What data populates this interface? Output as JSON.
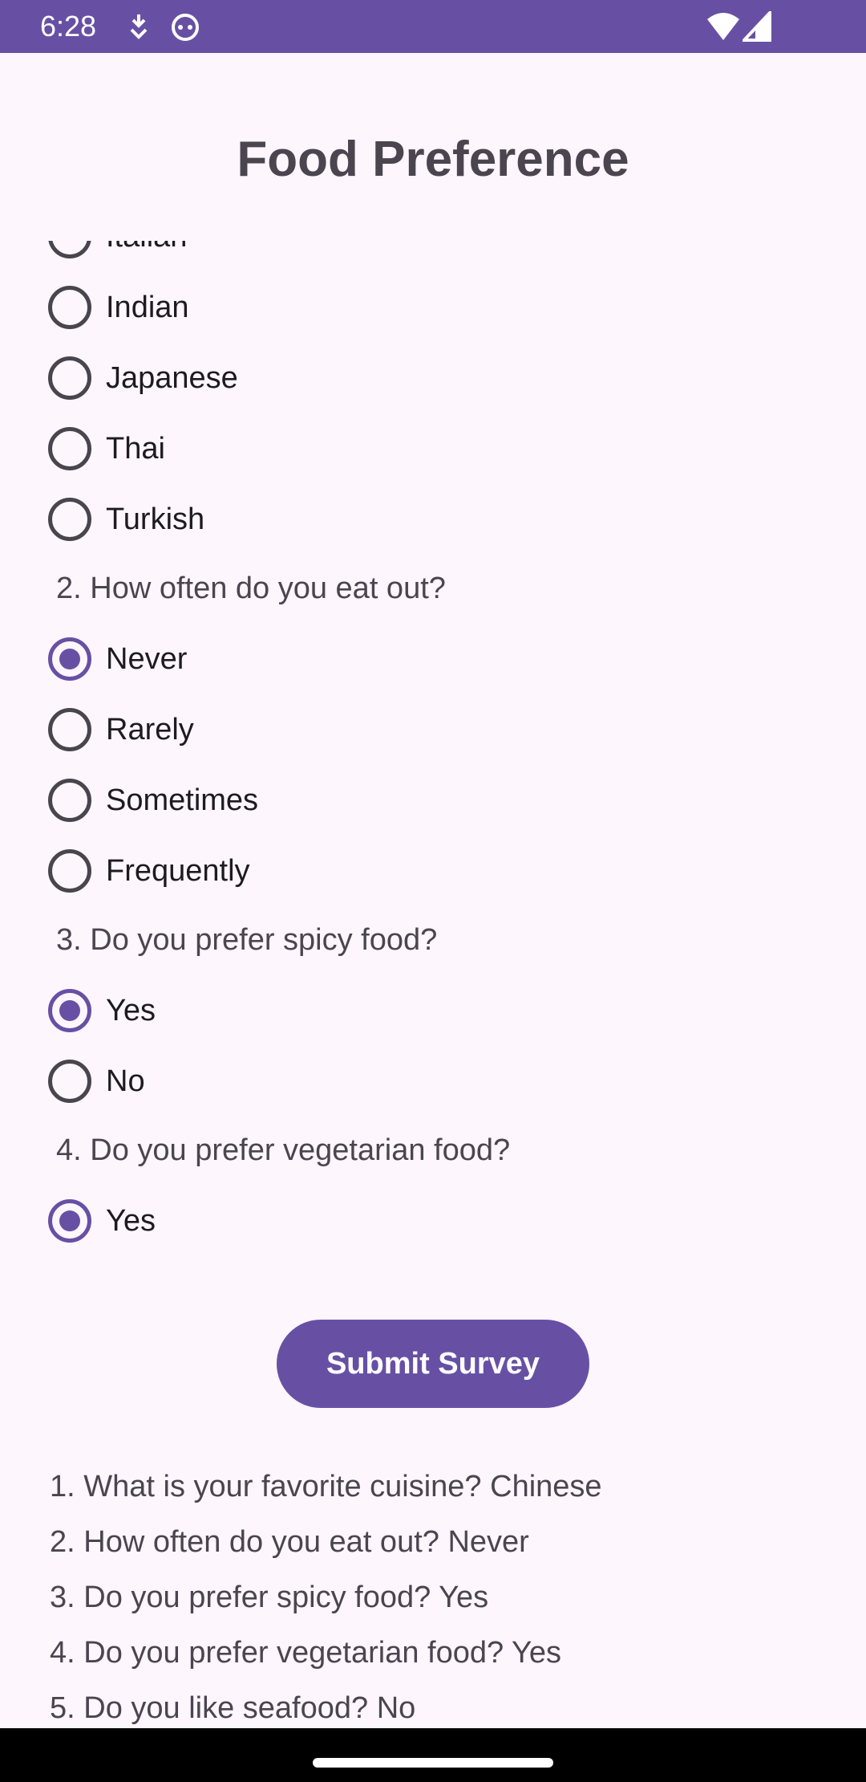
{
  "status_bar": {
    "time": "6:28",
    "icons": [
      "download-icon",
      "cat-face-icon",
      "wifi-icon",
      "cellular-signal-icon"
    ],
    "color": "#6750a4"
  },
  "title": "Food Preference",
  "questions": [
    {
      "label": "",
      "options": [
        {
          "label": "Italian",
          "checked": false
        },
        {
          "label": "Indian",
          "checked": false
        },
        {
          "label": "Japanese",
          "checked": false
        },
        {
          "label": "Thai",
          "checked": false
        },
        {
          "label": "Turkish",
          "checked": false
        }
      ]
    },
    {
      "label": "2. How often do you eat out?",
      "options": [
        {
          "label": "Never",
          "checked": true
        },
        {
          "label": "Rarely",
          "checked": false
        },
        {
          "label": "Sometimes",
          "checked": false
        },
        {
          "label": "Frequently",
          "checked": false
        }
      ]
    },
    {
      "label": "3. Do you prefer spicy food?",
      "options": [
        {
          "label": "Yes",
          "checked": true
        },
        {
          "label": "No",
          "checked": false
        }
      ]
    },
    {
      "label": "4. Do you prefer vegetarian food?",
      "options": [
        {
          "label": "Yes",
          "checked": true
        }
      ]
    }
  ],
  "submit_label": "Submit Survey",
  "results": [
    "1. What is your favorite cuisine? Chinese",
    "2. How often do you eat out? Never",
    "3. Do you prefer spicy food? Yes",
    "4. Do you prefer vegetarian food? Yes",
    "5. Do you like seafood? No"
  ],
  "colors": {
    "accent": "#6750a4",
    "background": "#fdf6fd",
    "text": "#4a454f"
  }
}
